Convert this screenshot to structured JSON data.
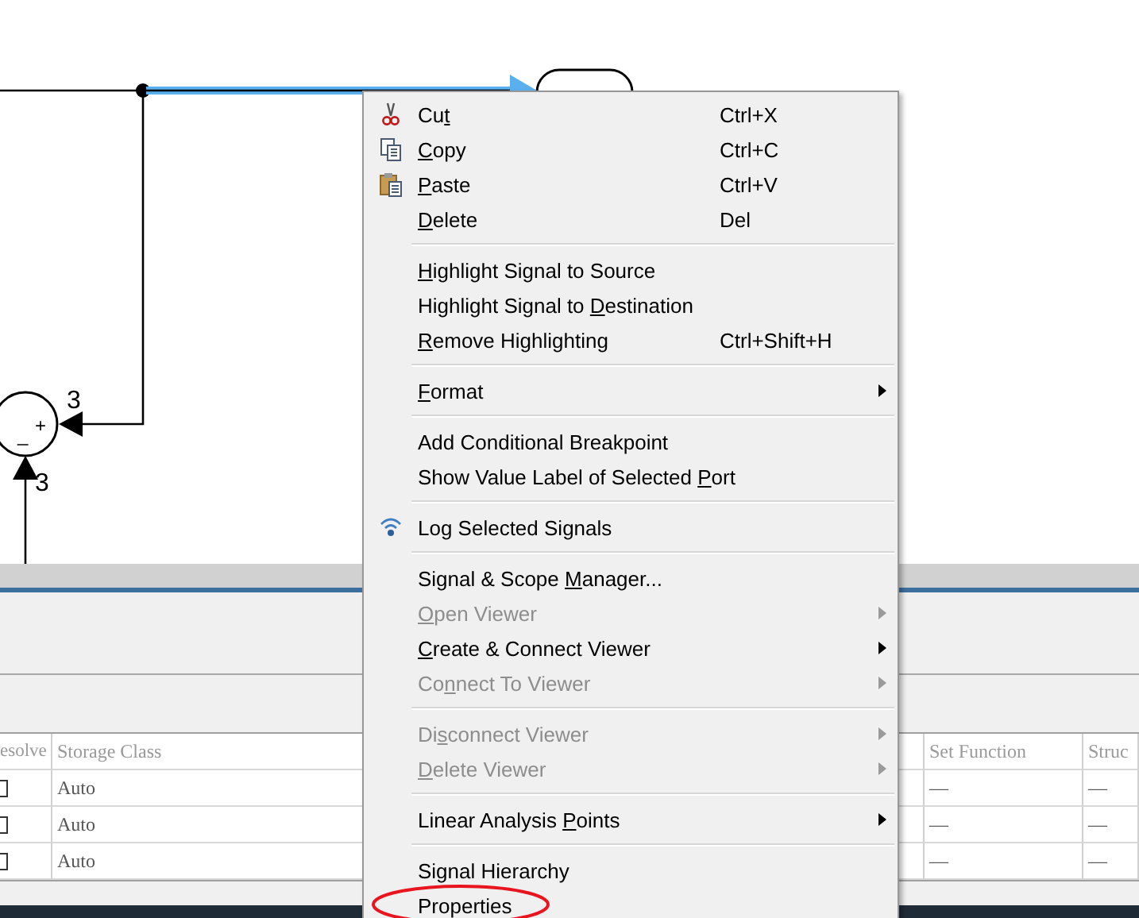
{
  "diagram": {
    "signal_selected": true,
    "sum_signs": [
      "+",
      "_"
    ],
    "dimension_labels": [
      "3",
      "3"
    ]
  },
  "context_menu": {
    "items": [
      {
        "kind": "item",
        "before": "Cu",
        "key": "t",
        "shortcut": "Ctrl+X",
        "disabled": false,
        "submenu": false,
        "circled": false
      },
      {
        "kind": "item",
        "key": "C",
        "after": "opy",
        "shortcut": "Ctrl+C",
        "disabled": false,
        "submenu": false,
        "circled": false
      },
      {
        "kind": "item",
        "key": "P",
        "after": "aste",
        "shortcut": "Ctrl+V",
        "disabled": false,
        "submenu": false,
        "circled": false
      },
      {
        "kind": "item",
        "key": "D",
        "after": "elete",
        "shortcut": "Del",
        "disabled": false,
        "submenu": false,
        "circled": false
      },
      {
        "kind": "separator"
      },
      {
        "kind": "item",
        "key": "H",
        "after": "ighlight Signal to Source",
        "disabled": false,
        "submenu": false,
        "circled": false
      },
      {
        "kind": "item",
        "before": "Highlight Signal to ",
        "key": "D",
        "after": "estination",
        "disabled": false,
        "submenu": false,
        "circled": false
      },
      {
        "kind": "item",
        "key": "R",
        "after": "emove Highlighting",
        "shortcut": "Ctrl+Shift+H",
        "disabled": false,
        "submenu": false,
        "circled": false
      },
      {
        "kind": "separator"
      },
      {
        "kind": "item",
        "key": "F",
        "after": "ormat",
        "disabled": false,
        "submenu": true,
        "circled": false
      },
      {
        "kind": "separator"
      },
      {
        "kind": "item",
        "before": "Add Conditional Breakpoint",
        "disabled": false,
        "submenu": false,
        "circled": false
      },
      {
        "kind": "item",
        "before": "Show Value Label of Selected ",
        "key": "P",
        "after": "ort",
        "disabled": false,
        "submenu": false,
        "circled": false
      },
      {
        "kind": "separator"
      },
      {
        "kind": "item",
        "before": "Log Selected Signals",
        "disabled": false,
        "submenu": false,
        "circled": false
      },
      {
        "kind": "separator"
      },
      {
        "kind": "item",
        "before": "Signal & Scope ",
        "key": "M",
        "after": "anager...",
        "disabled": false,
        "submenu": false,
        "circled": false
      },
      {
        "kind": "item",
        "key": "O",
        "after": "pen Viewer",
        "disabled": true,
        "submenu": true,
        "circled": false
      },
      {
        "kind": "item",
        "key": "C",
        "after": "reate & Connect Viewer",
        "disabled": false,
        "submenu": true,
        "circled": false
      },
      {
        "kind": "item",
        "before": "Co",
        "key": "n",
        "after": "nect To Viewer",
        "disabled": true,
        "submenu": true,
        "circled": false
      },
      {
        "kind": "separator"
      },
      {
        "kind": "item",
        "before": "Di",
        "key": "s",
        "after": "connect Viewer",
        "disabled": true,
        "submenu": true,
        "circled": false
      },
      {
        "kind": "item",
        "key": "D",
        "after": "elete Viewer",
        "disabled": true,
        "submenu": true,
        "circled": false
      },
      {
        "kind": "separator"
      },
      {
        "kind": "item",
        "before": "Linear Analysis ",
        "key": "P",
        "after": "oints",
        "disabled": false,
        "submenu": true,
        "circled": false
      },
      {
        "kind": "separator"
      },
      {
        "kind": "item",
        "before": "Signal Hierarchy",
        "disabled": false,
        "submenu": false,
        "circled": false
      },
      {
        "kind": "item",
        "before": "Properties",
        "disabled": false,
        "submenu": false,
        "circled": true
      }
    ]
  },
  "table": {
    "headers": {
      "column_1": "esolve",
      "storage_class": "Storage Class",
      "set_function": "Set Function",
      "column_5": "Struc"
    },
    "rows": [
      {
        "checked": false,
        "storage_class": "Auto",
        "set_function": "—",
        "column_5": "—"
      },
      {
        "checked": false,
        "storage_class": "Auto",
        "set_function": "—",
        "column_5": "—"
      },
      {
        "checked": false,
        "storage_class": "Auto",
        "set_function": "—",
        "column_5": "—"
      }
    ]
  }
}
